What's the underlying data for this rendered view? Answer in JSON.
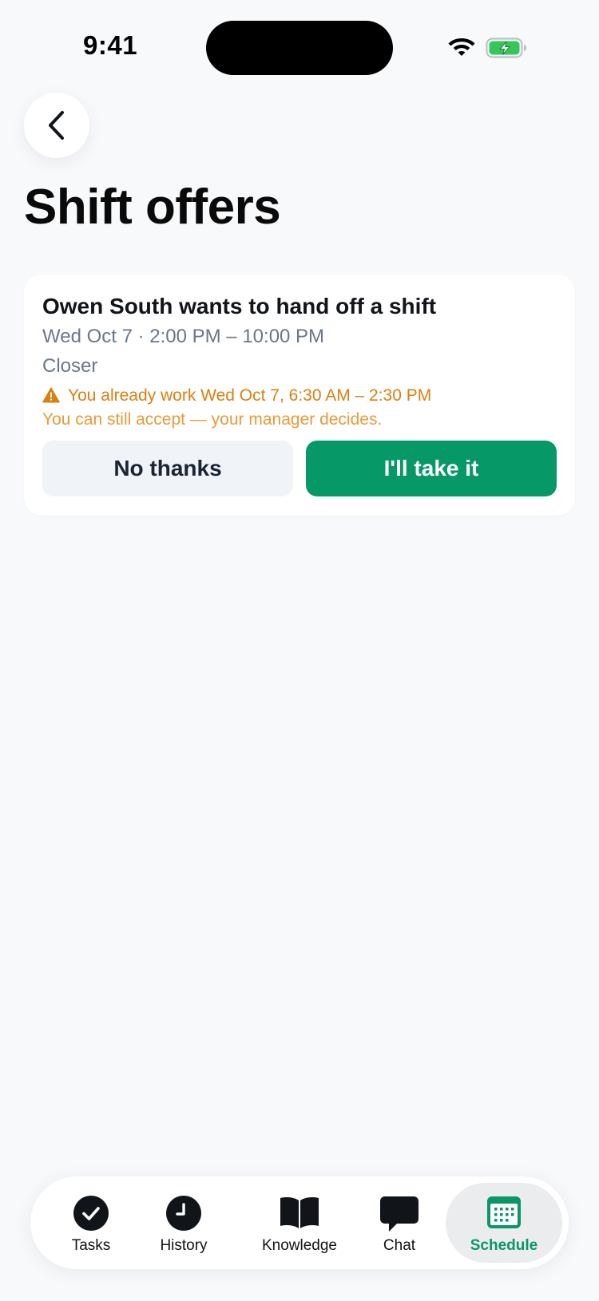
{
  "status_bar": {
    "time": "9:41"
  },
  "header": {
    "title": "Shift offers"
  },
  "offer": {
    "title": "Owen South wants to hand off a shift",
    "datetime": "Wed Oct 7 · 2:00 PM – 10:00 PM",
    "role": "Closer",
    "conflict_warning": "You already work Wed Oct 7, 6:30 AM – 2:30 PM",
    "conflict_note": "You can still accept — your manager decides.",
    "decline_label": "No thanks",
    "accept_label": "I'll take it"
  },
  "tab_bar": {
    "tasks": "Tasks",
    "history": "History",
    "knowledge": "Knowledge",
    "chat": "Chat",
    "schedule": "Schedule",
    "active": "schedule"
  },
  "colors": {
    "accent": "#069867",
    "warning": "#DB7F0E",
    "background": "#F8F9FB"
  }
}
